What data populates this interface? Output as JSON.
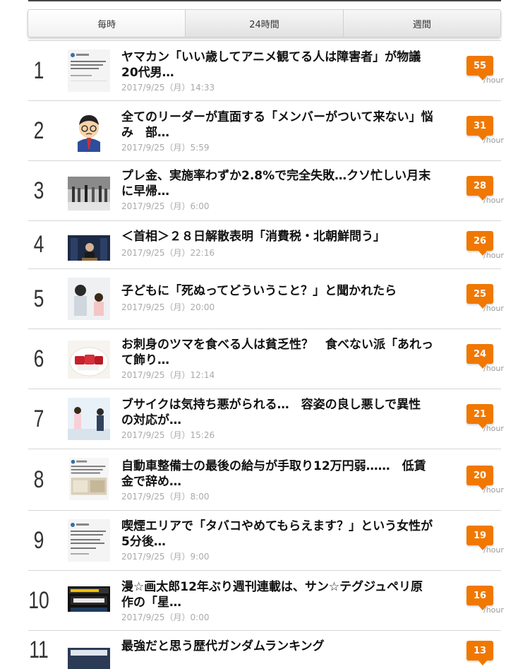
{
  "tabs": [
    {
      "label": "毎時",
      "active": true
    },
    {
      "label": "24時間",
      "active": false
    },
    {
      "label": "週間",
      "active": false
    }
  ],
  "unit": "/hour",
  "items": [
    {
      "rank": "1",
      "title_lines": [
        "ヤマカン「いい歳してアニメ観てる人は障害者」が物議",
        "20代男…"
      ],
      "date": "2017/9/25（月）14:33",
      "count": "55",
      "thumb": "tweet-thumbnail-icon"
    },
    {
      "rank": "2",
      "title_lines": [
        "全てのリーダーが直面する「メンバーがついて来ない」悩",
        "み　部…"
      ],
      "date": "2017/9/25（月）5:59",
      "count": "31",
      "thumb": "worried-businessman-illustration-icon"
    },
    {
      "rank": "3",
      "title_lines": [
        "プレ金、実施率わずか2.8%で完全失敗…クソ忙しい月末",
        "に早帰…"
      ],
      "date": "2017/9/25（月）6:00",
      "count": "28",
      "thumb": "street-crowd-photo-icon"
    },
    {
      "rank": "4",
      "title_lines": [
        "＜首相＞２８日解散表明「消費税・北朝鮮問う」"
      ],
      "date": "2017/9/25（月）22:16",
      "count": "26",
      "thumb": "press-conference-photo-icon"
    },
    {
      "rank": "5",
      "title_lines": [
        "子どもに「死ぬってどういうこと？」と聞かれたら"
      ],
      "date": "2017/9/25（月）20:00",
      "count": "25",
      "thumb": "parent-child-photo-icon"
    },
    {
      "rank": "6",
      "title_lines": [
        "お刺身のツマを食べる人は貧乏性？　食べない派「あれっ",
        "て飾り…"
      ],
      "date": "2017/9/25（月）12:14",
      "count": "24",
      "thumb": "sashimi-photo-icon"
    },
    {
      "rank": "7",
      "title_lines": [
        "ブサイクは気持ち悪がられる…　容姿の良し悪しで異性",
        "の対応が…"
      ],
      "date": "2017/9/25（月）15:26",
      "count": "21",
      "thumb": "office-scene-photo-icon"
    },
    {
      "rank": "8",
      "title_lines": [
        "自動車整備士の最後の給与が手取り12万円弱……　低賃",
        "金で辞め…"
      ],
      "date": "2017/9/25（月）8:00",
      "count": "20",
      "thumb": "tweet-with-image-thumbnail-icon"
    },
    {
      "rank": "9",
      "title_lines": [
        "喫煙エリアで「タバコやめてもらえます？」という女性が",
        "5分後…"
      ],
      "date": "2017/9/25（月）9:00",
      "count": "19",
      "thumb": "tweet-thumbnail-icon"
    },
    {
      "rank": "10",
      "title_lines": [
        "漫☆画太郎12年ぶり週刊連載は、サン☆テグジュペリ原",
        "作の「星…"
      ],
      "date": "2017/9/25（月）0:00",
      "count": "16",
      "thumb": "manga-cover-thumbnail-icon"
    },
    {
      "rank": "11",
      "title_lines": [
        "最強だと思う歴代ガンダムランキング"
      ],
      "date": "",
      "count": "13",
      "thumb": "gundam-ranking-thumbnail-icon"
    }
  ]
}
